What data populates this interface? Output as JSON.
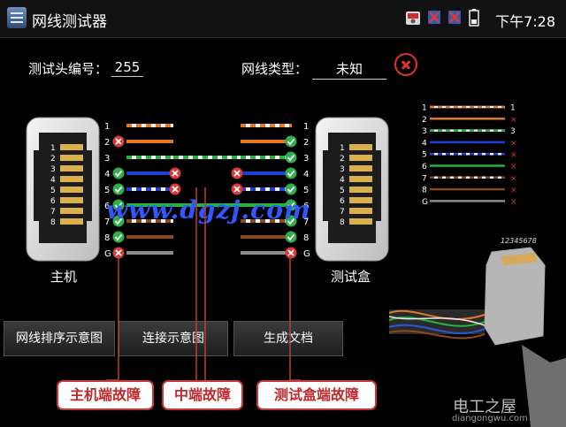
{
  "app": {
    "title": "网线测试器",
    "time": "下午7:28"
  },
  "status_icons": [
    "camera-icon",
    "ethernet-fault-icon",
    "ethernet-fault-icon",
    "battery-icon"
  ],
  "form": {
    "tester_id_label": "测试头编号：",
    "tester_id_value": "255",
    "cable_type_label": "网线类型：",
    "cable_type_value": "未知"
  },
  "ports": {
    "host_label": "主机",
    "remote_label": "测试盒"
  },
  "wiring": {
    "pins": [
      "1",
      "2",
      "3",
      "4",
      "5",
      "6",
      "7",
      "8",
      "G"
    ],
    "left_status": [
      "none",
      "fail",
      "none",
      "pass",
      "pass",
      "pass",
      "pass",
      "pass",
      "fail"
    ],
    "left_mid_status": [
      "none",
      "none",
      "none",
      "fail",
      "fail",
      "none",
      "none",
      "none",
      "none"
    ],
    "right_mid_status": [
      "none",
      "none",
      "none",
      "fail",
      "fail",
      "none",
      "none",
      "none",
      "none"
    ],
    "right_status": [
      "none",
      "pass",
      "pass",
      "pass",
      "pass",
      "pass",
      "pass",
      "pass",
      "fail"
    ]
  },
  "pin_map": {
    "left_pins": [
      "1",
      "2",
      "3",
      "4",
      "5",
      "6",
      "7",
      "8",
      "G"
    ],
    "right_pins": [
      "1",
      "",
      "3",
      "",
      "",
      "",
      "",
      "",
      ""
    ],
    "marks": [
      "none",
      "x",
      "none",
      "x",
      "x",
      "x",
      "x",
      "x",
      "x"
    ],
    "connector_code": "12345678"
  },
  "buttons": {
    "sort_diagram": "网线排序示意图",
    "connection_diagram": "连接示意图",
    "generate_doc": "生成文档"
  },
  "annotations": {
    "host_fault": "主机端故障",
    "middle_fault": "中端故障",
    "remote_fault": "测试盒端故障"
  },
  "watermark": {
    "url": "www.dgzj.com",
    "site_cn": "电工之屋",
    "site_en": "diangongwu.com"
  },
  "colors": {
    "background": "#000000",
    "pass": "#2fae4a",
    "fail": "#d83a36",
    "annotation_border": "#c43a3a",
    "wire_orange": "#e07a2a",
    "wire_green": "#24b43c",
    "wire_blue": "#1f3fd8",
    "wire_brown": "#8a4a1e",
    "wire_grey": "#8c8c8c"
  }
}
